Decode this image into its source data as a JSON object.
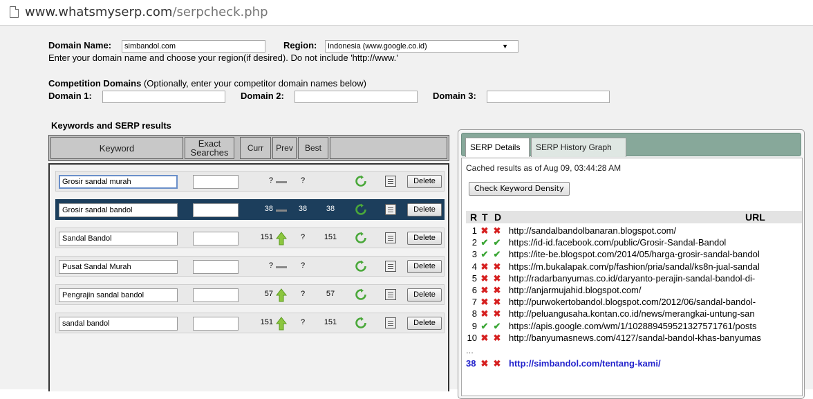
{
  "browser": {
    "url_host": "www.whatsmyserp.com",
    "url_path": "/serpcheck.php"
  },
  "form": {
    "domain_name_label": "Domain Name:",
    "domain_name_value": "simbandol.com",
    "region_label": "Region:",
    "region_value": "Indonesia (www.google.co.id)",
    "hint": "Enter your domain name and choose your region(if desired). Do not include 'http://www.'",
    "competition_title": "Competition Domains",
    "competition_hint": " (Optionally, enter your competitor domain names below)",
    "domain1_label": "Domain 1:",
    "domain2_label": "Domain 2:",
    "domain3_label": "Domain 3:"
  },
  "keywords": {
    "section_title": "Keywords and SERP results",
    "headers": {
      "keyword": "Keyword",
      "exact_line1": "Exact",
      "exact_line2": "Searches",
      "curr": "Curr",
      "prev": "Prev",
      "best": "Best"
    },
    "delete_label": "Delete",
    "rows": [
      {
        "keyword": "Grosir sandal murah",
        "curr": "?",
        "trend": "flat",
        "prev": "?",
        "best": ""
      },
      {
        "keyword": "Grosir sandal bandol",
        "curr": "38",
        "trend": "flat",
        "prev": "38",
        "best": "38"
      },
      {
        "keyword": "Sandal Bandol",
        "curr": "151",
        "trend": "up",
        "prev": "?",
        "best": "151"
      },
      {
        "keyword": "Pusat Sandal Murah",
        "curr": "?",
        "trend": "flat",
        "prev": "?",
        "best": ""
      },
      {
        "keyword": "Pengrajin sandal bandol",
        "curr": "57",
        "trend": "up",
        "prev": "?",
        "best": "57"
      },
      {
        "keyword": "sandal bandol",
        "curr": "151",
        "trend": "up",
        "prev": "?",
        "best": "151"
      }
    ]
  },
  "serp": {
    "tab_details": "SERP Details",
    "tab_history": "SERP History Graph",
    "cached": "Cached results as of Aug 09, 03:44:28 AM",
    "check_density": "Check Keyword Density",
    "col_r": "R",
    "col_t": "T",
    "col_d": "D",
    "col_url": "URL",
    "ellipsis": "...",
    "results": [
      {
        "n": "1",
        "t": "x",
        "d": "x",
        "url": "http://sandalbandolbanaran.blogspot.com/"
      },
      {
        "n": "2",
        "t": "ok",
        "d": "ok",
        "url": "https://id-id.facebook.com/public/Grosir-Sandal-Bandol"
      },
      {
        "n": "3",
        "t": "ok",
        "d": "ok",
        "url": "https://ite-be.blogspot.com/2014/05/harga-grosir-sandal-bandol"
      },
      {
        "n": "4",
        "t": "x",
        "d": "x",
        "url": "https://m.bukalapak.com/p/fashion/pria/sandal/ks8n-jual-sandal"
      },
      {
        "n": "5",
        "t": "x",
        "d": "x",
        "url": "http://radarbanyumas.co.id/daryanto-perajin-sandal-bandol-di-"
      },
      {
        "n": "6",
        "t": "x",
        "d": "x",
        "url": "http://anjarmujahid.blogspot.com/"
      },
      {
        "n": "7",
        "t": "x",
        "d": "x",
        "url": "http://purwokertobandol.blogspot.com/2012/06/sandal-bandol-"
      },
      {
        "n": "8",
        "t": "x",
        "d": "x",
        "url": "http://peluangusaha.kontan.co.id/news/merangkai-untung-san"
      },
      {
        "n": "9",
        "t": "ok",
        "d": "ok",
        "url": "https://apis.google.com/wm/1/102889459521327571761/posts"
      },
      {
        "n": "10",
        "t": "x",
        "d": "x",
        "url": "http://banyumasnews.com/4127/sandal-bandol-khas-banyumas"
      }
    ],
    "highlight": {
      "n": "38",
      "t": "x",
      "d": "x",
      "url": "http://simbandol.com/tentang-kami/"
    }
  }
}
